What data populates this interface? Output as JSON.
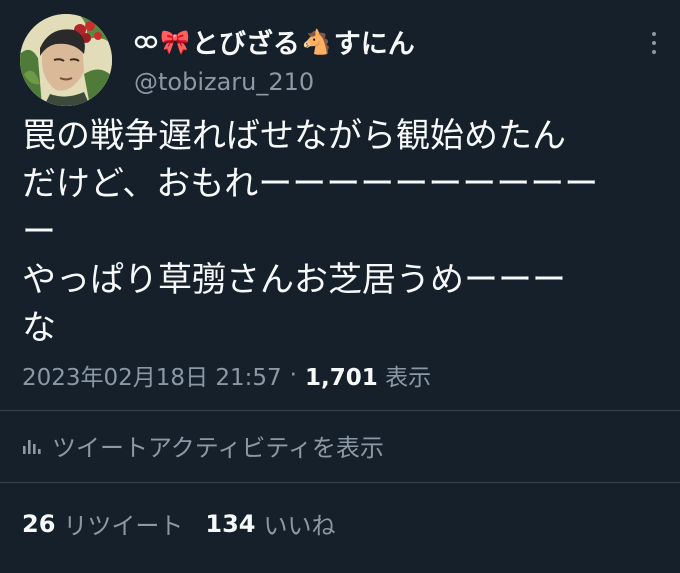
{
  "user": {
    "display_name_text": "とびざる",
    "display_name_suffix": "すにん",
    "name_emojis": [
      "infinity-link-icon",
      "ribbon-emoji",
      "horse-emoji"
    ],
    "handle": "@tobizaru_210"
  },
  "tweet": {
    "lines": [
      "罠の戦争遅ればせながら観始めたん",
      "だけど、おもれーーーーーーーーーー",
      "ー",
      "やっぱり草彅さんお芝居うめーーー",
      "な"
    ],
    "timestamp": "2023年02月18日 21:57",
    "separator": "·",
    "views_count": "1,701",
    "views_label": "表示"
  },
  "activity": {
    "label": "ツイートアクティビティを表示",
    "icon": "bar-chart-icon"
  },
  "stats": {
    "retweets_count": "26",
    "retweets_label": "リツイート",
    "likes_count": "134",
    "likes_label": "いいね"
  },
  "colors": {
    "background": "#15202b",
    "text": "#f7f9f9",
    "secondary": "#8b98a5",
    "divider": "#38444d"
  }
}
